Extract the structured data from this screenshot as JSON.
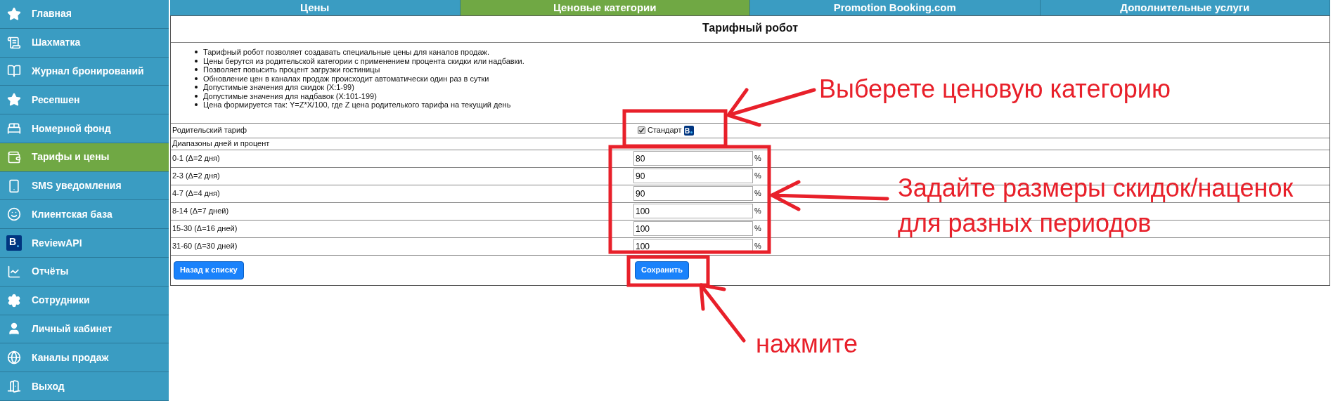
{
  "sidebar": {
    "items": [
      {
        "label": "Главная",
        "selected": false
      },
      {
        "label": "Шахматка",
        "selected": false
      },
      {
        "label": "Журнал бронирований",
        "selected": false
      },
      {
        "label": "Ресепшен",
        "selected": false
      },
      {
        "label": "Номерной фонд",
        "selected": false
      },
      {
        "label": "Тарифы и цены",
        "selected": true
      },
      {
        "label": "SMS уведомления",
        "selected": false
      },
      {
        "label": "Клиентская база",
        "selected": false
      },
      {
        "label": "ReviewAPI",
        "selected": false,
        "badge": "B"
      },
      {
        "label": "Отчёты",
        "selected": false
      },
      {
        "label": "Сотрудники",
        "selected": false
      },
      {
        "label": "Личный кабинет",
        "selected": false
      },
      {
        "label": "Каналы продаж",
        "selected": false
      },
      {
        "label": "Выход",
        "selected": false
      }
    ]
  },
  "tabs": [
    {
      "label": "Цены",
      "selected": false
    },
    {
      "label": "Ценовые категории",
      "selected": true
    },
    {
      "label": "Promotion Booking.com",
      "selected": false
    },
    {
      "label": "Дополнительные услуги",
      "selected": false
    }
  ],
  "title": "Тарифный робот",
  "notes": [
    "Тарифный робот позволяет создавать специальные цены для каналов продаж.",
    "Цены берутся из родительской категории с применением процента скидки или надбавки.",
    "Позволяет повысить процент загрузки гостиницы",
    "Обновление цен в каналах продаж происходит автоматически один раз в сутки",
    "Допустимые значения для скидок (X:1-99)",
    "Допустимые значения для надбавок (X:101-199)",
    "Цена формируется так: Y=Z*X/100, где Z цена родителького тарифа на текущий день"
  ],
  "parent_tariff": {
    "label": "Родительский тариф",
    "option": "Стандарт",
    "checked": true,
    "badge": "B"
  },
  "ranges_label": "Диапазоны дней и процент",
  "ranges": [
    {
      "label": "0-1 (Δ=2 дня)",
      "value": "80",
      "unit": "%"
    },
    {
      "label": "2-3 (Δ=2 дня)",
      "value": "90",
      "unit": "%"
    },
    {
      "label": "4-7 (Δ=4 дня)",
      "value": "90",
      "unit": "%"
    },
    {
      "label": "8-14 (Δ=7 дней)",
      "value": "100",
      "unit": "%"
    },
    {
      "label": "15-30 (Δ=16 дней)",
      "value": "100",
      "unit": "%"
    },
    {
      "label": "31-60 (Δ=30 дней)",
      "value": "100",
      "unit": "%"
    }
  ],
  "buttons": {
    "back": "Назад к списку",
    "save": "Сохранить"
  },
  "annotations": [
    {
      "lines": [
        "Выберете ценовую категорию"
      ]
    },
    {
      "lines": [
        "Задайте размеры скидок/наценок",
        "для разных периодов"
      ]
    },
    {
      "lines": [
        "нажмите"
      ]
    }
  ]
}
